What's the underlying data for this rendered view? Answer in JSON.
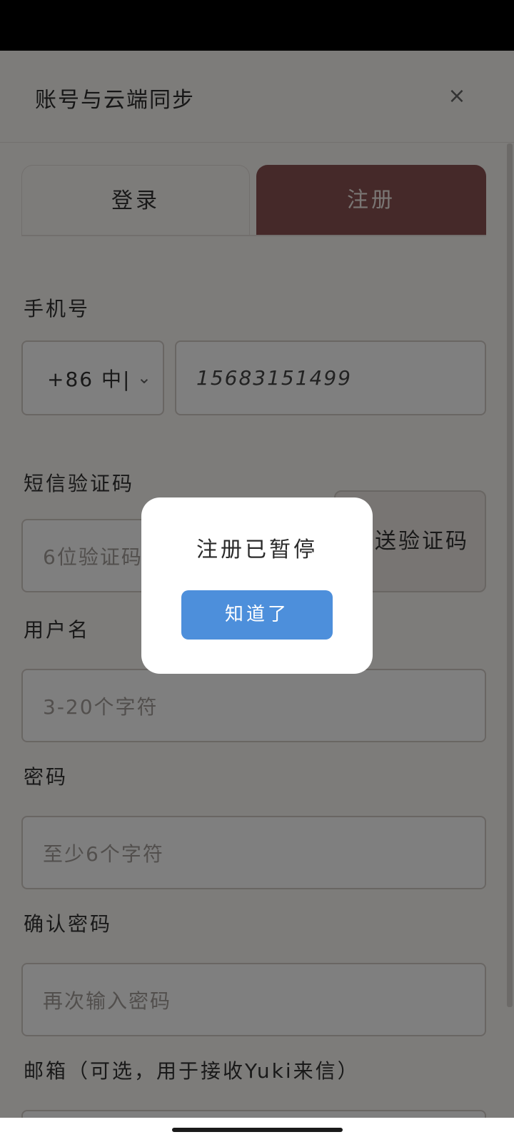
{
  "header": {
    "title": "账号与云端同步",
    "close_glyph": "×"
  },
  "tabs": [
    {
      "label": "登录",
      "active": false
    },
    {
      "label": "注册",
      "active": true
    }
  ],
  "form": {
    "phone_label": "手机号",
    "country_value": "+86 中|",
    "phone_value": "15683151499",
    "sms_label": "短信验证码",
    "sms_placeholder": "6位验证码",
    "send_code_label": "发送验证码",
    "username_label": "用户名",
    "username_placeholder": "3-20个字符",
    "password_label": "密码",
    "password_placeholder": "至少6个字符",
    "confirm_label": "确认密码",
    "confirm_placeholder": "再次输入密码",
    "email_label": "邮箱（可选，用于接收Yuki来信）"
  },
  "dialog": {
    "message": "注册已暂停",
    "ok_label": "知道了"
  },
  "colors": {
    "accent_tab": "#8a5352",
    "dialog_button": "#4d8fdb"
  }
}
